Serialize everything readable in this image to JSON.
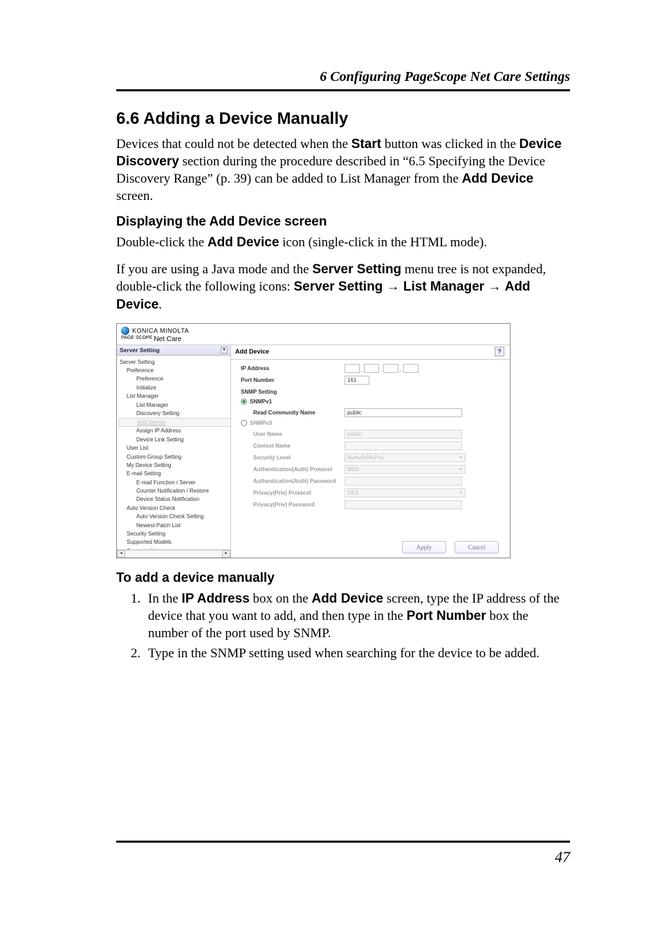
{
  "header": "6  Configuring PageScope Net Care Settings",
  "section_title": "6.6  Adding a Device Manually",
  "intro_parts": {
    "a": "Devices that could not be detected when the ",
    "b": "Start",
    "c": " button was clicked in the ",
    "d": "Device Discovery",
    "e": " section during the procedure described in “6.5 Specifying the Device Discovery Range” (p. 39) can be added to List Manager from the ",
    "f": "Add Device",
    "g": " screen."
  },
  "sub1": "Displaying the Add Device screen",
  "p2_parts": {
    "a": "Double-click the ",
    "b": "Add Device",
    "c": " icon (single-click in the HTML mode)."
  },
  "p3_parts": {
    "a": "If you are using a Java mode and the ",
    "b": "Server Setting",
    "c": " menu tree is not expanded, double-click the following icons: ",
    "d": "Server Setting",
    "e": "List Manager",
    "f": "Add Device",
    "arrow": " → ",
    "period": "."
  },
  "screenshot": {
    "brand": "KONICA MINOLTA",
    "product_prefix": "PAGE SCOPE ",
    "product": "Net Care",
    "sidebar_head": "Server Setting",
    "tree": [
      {
        "lvl": 0,
        "label": "Server Setting"
      },
      {
        "lvl": 1,
        "label": "Preference"
      },
      {
        "lvl": 2,
        "label": "Preference"
      },
      {
        "lvl": 2,
        "label": "Initialize"
      },
      {
        "lvl": 1,
        "label": "List Manager"
      },
      {
        "lvl": 2,
        "label": "List Manager"
      },
      {
        "lvl": 2,
        "label": "Discovery Setting"
      },
      {
        "lvl": 2,
        "label": "Add Device",
        "sel": true
      },
      {
        "lvl": 2,
        "label": "Assign IP Address"
      },
      {
        "lvl": 2,
        "label": "Device Link Setting"
      },
      {
        "lvl": 1,
        "label": "User List"
      },
      {
        "lvl": 1,
        "label": "Custom Group Setting"
      },
      {
        "lvl": 1,
        "label": "My Device Setting"
      },
      {
        "lvl": 1,
        "label": "E-mail Setting"
      },
      {
        "lvl": 2,
        "label": "E-mail Function / Server"
      },
      {
        "lvl": 2,
        "label": "Counter Notification / Restore"
      },
      {
        "lvl": 2,
        "label": "Device Status Notification"
      },
      {
        "lvl": 1,
        "label": "Auto Version Check"
      },
      {
        "lvl": 2,
        "label": "Auto Version Check Setting"
      },
      {
        "lvl": 2,
        "label": "Newest Patch List"
      },
      {
        "lvl": 1,
        "label": "Security Setting"
      },
      {
        "lvl": 1,
        "label": "Supported Models"
      },
      {
        "lvl": 1,
        "label": "Supported Language"
      }
    ],
    "main_title": "Add Device",
    "help": "?",
    "labels": {
      "ip": "IP Address",
      "port": "Port Number",
      "snmp_setting": "SNMP Setting",
      "v1": "SNMPv1",
      "read_comm": "Read Community Name",
      "v3": "SNMPv3",
      "user_name": "User Name",
      "context": "Context Name",
      "sec_level": "Security Level",
      "auth_proto": "Authentication(Auth) Protocol",
      "auth_pass": "Authentication(Auth) Password",
      "priv_proto": "Privacy(Priv) Protocol",
      "priv_pass": "Privacy(Priv) Password"
    },
    "values": {
      "port": "161",
      "read_comm": "public",
      "user_name": "public",
      "sec_level": "NoAuth/NoPriv",
      "auth_proto": "MD5",
      "priv_proto": "DES"
    },
    "buttons": {
      "apply": "Apply",
      "cancel": "Cancel"
    }
  },
  "sub2": "To add a device manually",
  "step1_parts": {
    "a": "In the ",
    "b": "IP Address",
    "c": " box on the ",
    "d": "Add Device",
    "e": " screen, type the IP address of the device that you want to add, and then type in the ",
    "f": "Port Number",
    "g": " box the number of the port used by SNMP."
  },
  "step2": "Type in the SNMP setting used when searching for the device to be added.",
  "pagenum": "47"
}
